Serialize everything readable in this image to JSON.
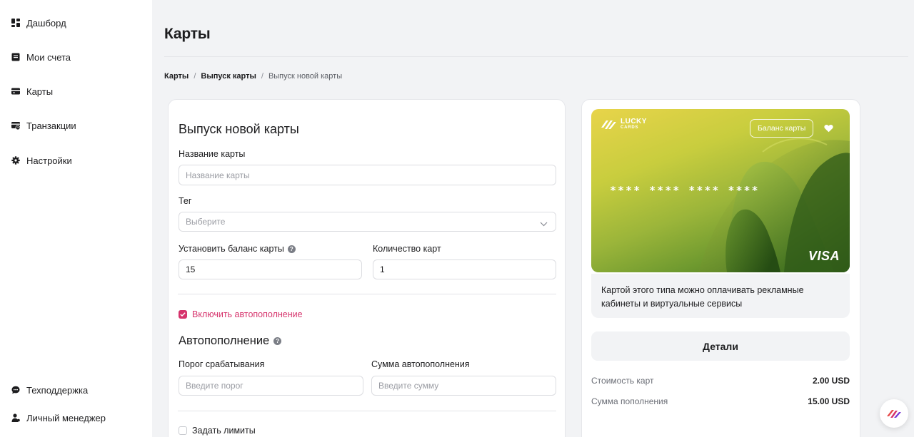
{
  "sidebar": {
    "items": [
      {
        "label": "Дашборд",
        "icon": "dashboard-icon"
      },
      {
        "label": "Мои счета",
        "icon": "accounts-icon"
      },
      {
        "label": "Карты",
        "icon": "card-icon"
      },
      {
        "label": "Транзакции",
        "icon": "transactions-icon"
      },
      {
        "label": "Настройки",
        "icon": "gear-icon"
      }
    ],
    "bottom": [
      {
        "label": "Техподдержка",
        "icon": "chat-icon"
      },
      {
        "label": "Личный менеджер",
        "icon": "manager-icon"
      }
    ]
  },
  "page": {
    "title": "Карты",
    "breadcrumb": [
      "Карты",
      "Выпуск карты",
      "Выпуск новой карты"
    ],
    "breadcrumb_sep": "/"
  },
  "form": {
    "heading": "Выпуск новой карты",
    "card_name_label": "Название карты",
    "card_name_placeholder": "Название карты",
    "tag_label": "Тег",
    "tag_placeholder": "Выберите",
    "balance_label": "Установить баланс карты",
    "balance_value": "15",
    "quantity_label": "Количество карт",
    "quantity_value": "1",
    "autofill_toggle_label": "Включить автопополнение",
    "autofill_heading": "Автопополнение",
    "threshold_label": "Порог срабатывания",
    "threshold_placeholder": "Введите порог",
    "autofill_amount_label": "Сумма автопополнения",
    "autofill_amount_placeholder": "Введите сумму",
    "limits_label": "Задать лимиты"
  },
  "card": {
    "logo_line1": "LUCKY",
    "logo_line2": "CARDS",
    "balance_button": "Баланс карты",
    "number": "**** **** **** ****",
    "brand": "VISA",
    "description": "Картой этого типа можно оплачивать рекламные кабинеты и виртуальные сервисы",
    "details_button": "Детали",
    "summary": [
      {
        "label": "Стоимость карт",
        "value": "2.00 USD"
      },
      {
        "label": "Сумма пополнения",
        "value": "15.00 USD"
      }
    ]
  },
  "colors": {
    "accent": "#d6336c",
    "background": "#f2f3f5"
  }
}
